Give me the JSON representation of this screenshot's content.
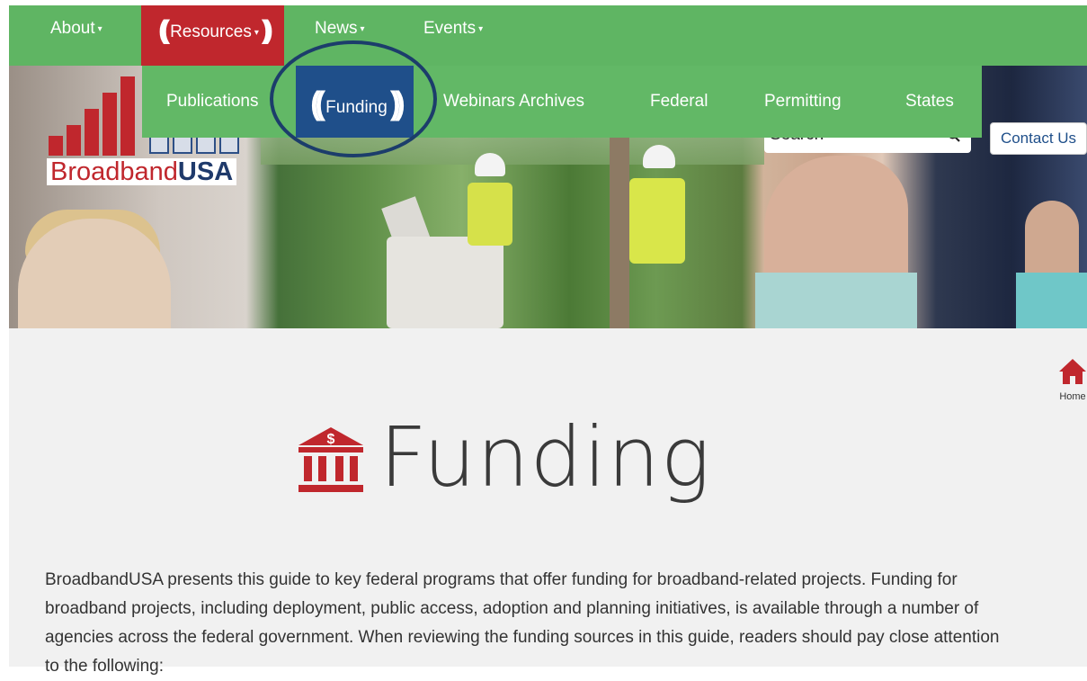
{
  "nav": {
    "about": "About",
    "resources": "Resources",
    "news": "News",
    "events": "Events",
    "caret": "▾"
  },
  "dropdown": {
    "items": [
      {
        "label": "Publications"
      },
      {
        "label": "Funding"
      },
      {
        "label": "Webinars Archives"
      },
      {
        "label": "Federal"
      },
      {
        "label": "Permitting"
      },
      {
        "label": "States"
      }
    ]
  },
  "logo": {
    "broadband": "Broadband",
    "usa": "USA"
  },
  "search": {
    "placeholder": "Search"
  },
  "contact": {
    "label": "Contact Us"
  },
  "home": {
    "label": "Home"
  },
  "page": {
    "title": "Funding",
    "intro": "BroadbandUSA presents this guide to key federal programs that offer funding for broadband-related projects. Funding for broadband projects, including deployment, public access, adoption and planning initiatives, is available through a number of agencies across the federal government. When reviewing the funding sources in this guide, readers should pay close attention to the following:"
  },
  "colors": {
    "nav_green": "#5fb563",
    "resources_red": "#c0272d",
    "funding_blue": "#1f4f8a",
    "brand_red": "#c0272d",
    "brand_navy": "#1f3a6b"
  },
  "icons": {
    "search": "magnifier-icon",
    "home": "home-icon",
    "bank": "bank-dollar-icon",
    "broadcast": "broadcast-waves-icon"
  }
}
